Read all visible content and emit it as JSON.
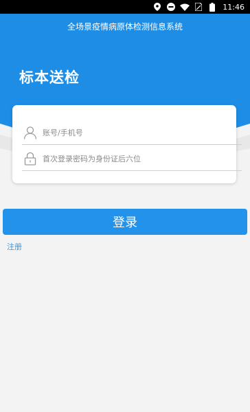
{
  "status_bar": {
    "time": "11:46",
    "icons": [
      "location-icon",
      "do-not-disturb-icon",
      "wifi-icon",
      "sim-card-icon",
      "battery-icon"
    ]
  },
  "header": {
    "app_title": "全场景疫情病原体检测信息系统",
    "page_heading": "标本送检"
  },
  "form": {
    "account_placeholder": "账号/手机号",
    "password_placeholder": "首次登录密码为身份证后六位",
    "account_icon": "user-icon",
    "password_icon": "lock-icon"
  },
  "actions": {
    "login_label": "登录",
    "register_label": "注册"
  },
  "colors": {
    "primary": "#1e8de6",
    "button": "#2292ea",
    "link": "#3f93d6",
    "background": "#f3f3f3"
  }
}
